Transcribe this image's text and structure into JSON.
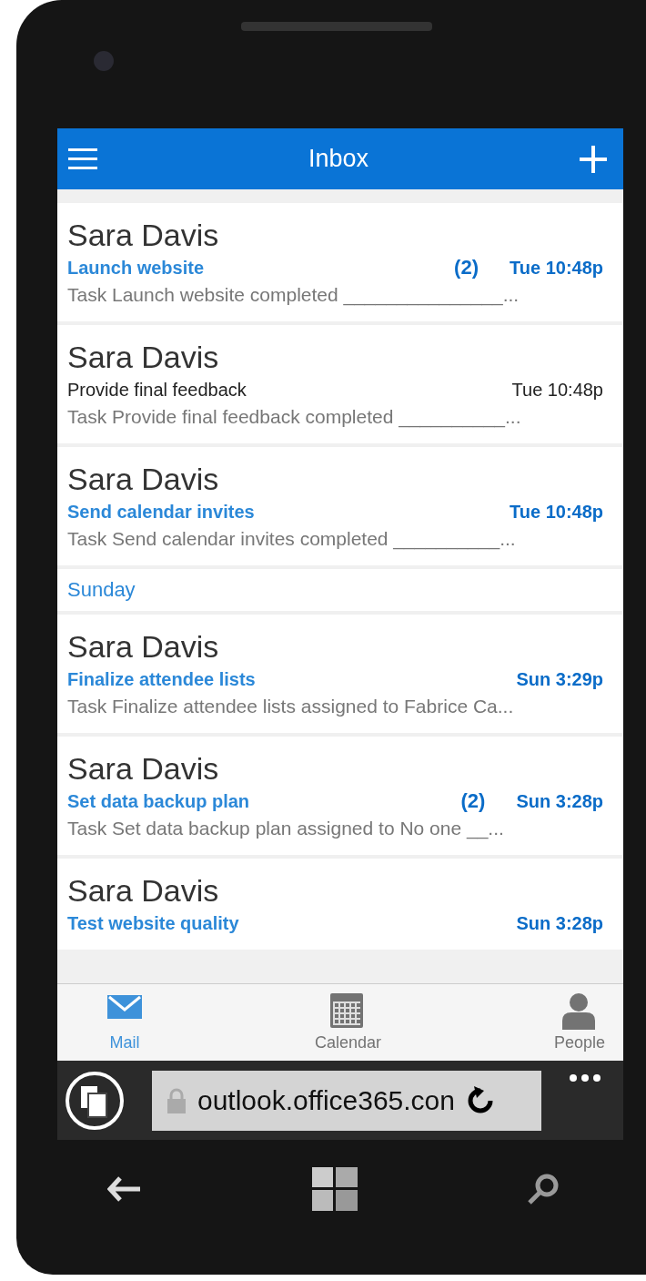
{
  "header": {
    "title": "Inbox"
  },
  "messages": [
    {
      "kind": "message",
      "sender": "Sara Davis",
      "subject": "Launch website",
      "count": "(2)",
      "time": "Tue 10:48p",
      "preview": "Task Launch website completed _______________...",
      "unread": true
    },
    {
      "kind": "message",
      "sender": "Sara Davis",
      "subject": "Provide final feedback",
      "time": "Tue 10:48p",
      "preview": "Task Provide final feedback completed __________...",
      "unread": false
    },
    {
      "kind": "message",
      "sender": "Sara Davis",
      "subject": "Send calendar invites",
      "time": "Tue 10:48p",
      "preview": "Task Send calendar invites completed __________...",
      "unread": true
    },
    {
      "kind": "day",
      "label": "Sunday"
    },
    {
      "kind": "message",
      "sender": "Sara Davis",
      "subject": "Finalize attendee lists",
      "time": "Sun 3:29p",
      "preview": "Task Finalize attendee lists assigned to Fabrice Ca...",
      "unread": true
    },
    {
      "kind": "message",
      "sender": "Sara Davis",
      "subject": "Set data backup plan",
      "count": "(2)",
      "time": "Sun 3:28p",
      "preview": "Task Set data backup plan assigned to No one __...",
      "unread": true
    },
    {
      "kind": "message",
      "sender": "Sara Davis",
      "subject": "Test website quality",
      "time": "Sun 3:28p",
      "unread": true
    }
  ],
  "tabs": [
    {
      "label": "Mail",
      "kind": "mail",
      "selected": true
    },
    {
      "label": "Calendar",
      "kind": "calendar",
      "selected": false
    },
    {
      "label": "People",
      "kind": "person",
      "selected": false
    }
  ],
  "browser": {
    "url": "outlook.office365.con"
  }
}
